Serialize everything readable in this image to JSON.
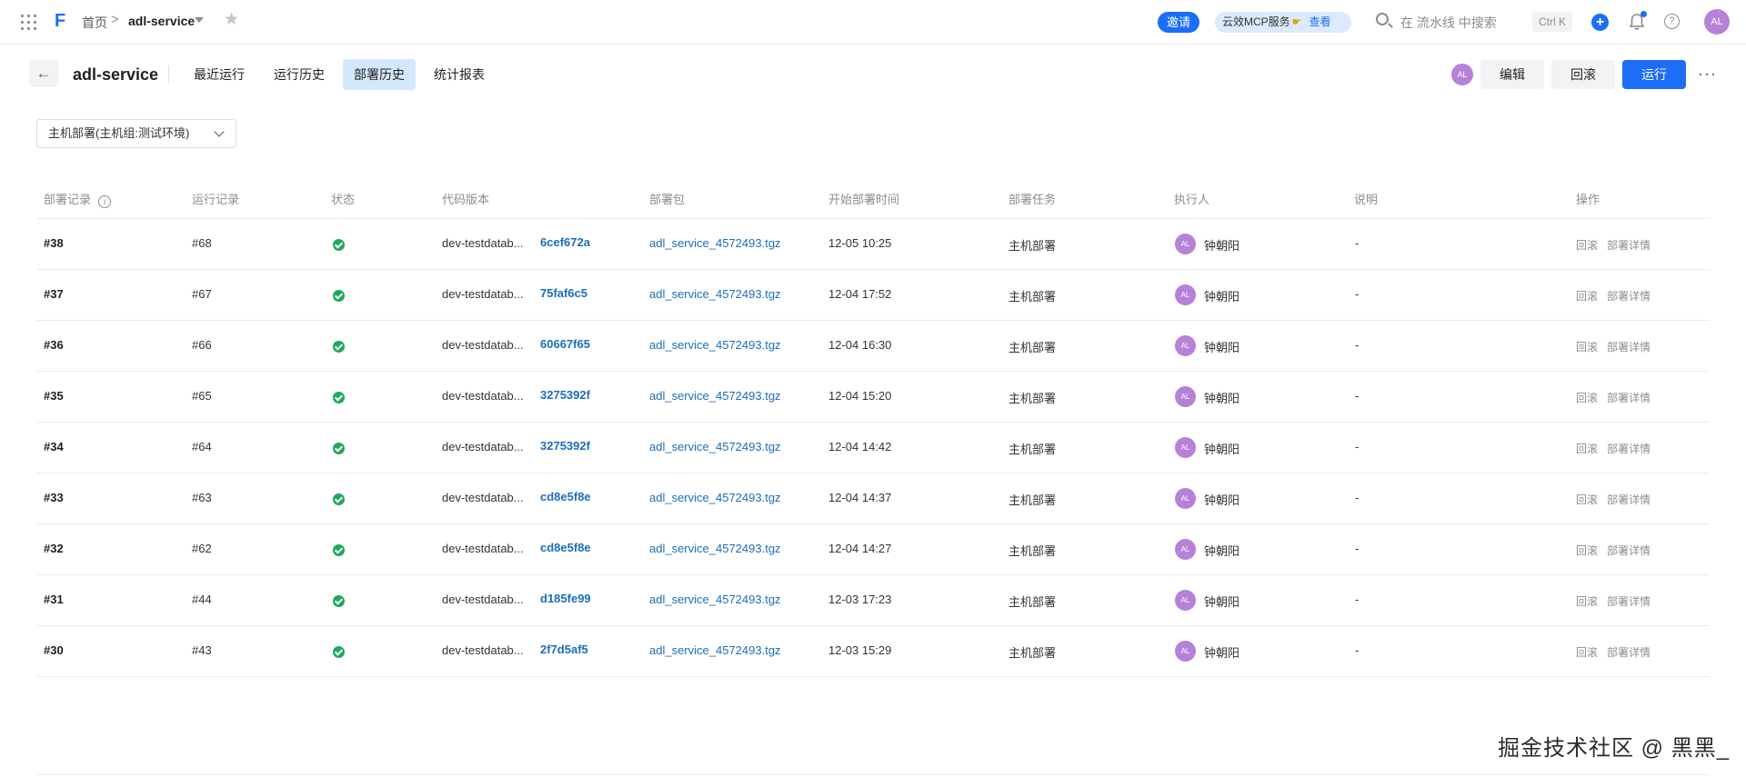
{
  "topbar": {
    "home": "首页",
    "sep": ">",
    "current": "adl-service",
    "invite": "邀请",
    "mcp_text": "云效MCP服务",
    "mcp_view": "查看",
    "search_placeholder": "在 流水线 中搜索",
    "shortcut": "Ctrl K",
    "avatar": "AL"
  },
  "header": {
    "back": "←",
    "title": "adl-service",
    "tabs": [
      {
        "label": "最近运行"
      },
      {
        "label": "运行历史"
      },
      {
        "label": "部署历史"
      },
      {
        "label": "统计报表"
      }
    ],
    "active_tab": "部署历史",
    "avatar": "AL",
    "edit": "编辑",
    "rollback": "回滚",
    "run": "运行",
    "more": "···"
  },
  "filter": {
    "selected": "主机部署(主机组:测试环境)"
  },
  "table": {
    "columns": [
      "部署记录",
      "运行记录",
      "状态",
      "代码版本",
      "部署包",
      "开始部署时间",
      "部署任务",
      "执行人",
      "说明",
      "操作"
    ],
    "rows": [
      {
        "deploy": "#38",
        "run": "#68",
        "branch": "dev-testdatab...",
        "commit": "6cef672a",
        "package": "adl_service_4572493.tgz",
        "time": "12-05 10:25",
        "task": "主机部署",
        "avatar": "AL",
        "user": "钟朝阳",
        "note": "-",
        "op1": "回滚",
        "op2": "部署详情"
      },
      {
        "deploy": "#37",
        "run": "#67",
        "branch": "dev-testdatab...",
        "commit": "75faf6c5",
        "package": "adl_service_4572493.tgz",
        "time": "12-04 17:52",
        "task": "主机部署",
        "avatar": "AL",
        "user": "钟朝阳",
        "note": "-",
        "op1": "回滚",
        "op2": "部署详情"
      },
      {
        "deploy": "#36",
        "run": "#66",
        "branch": "dev-testdatab...",
        "commit": "60667f65",
        "package": "adl_service_4572493.tgz",
        "time": "12-04 16:30",
        "task": "主机部署",
        "avatar": "AL",
        "user": "钟朝阳",
        "note": "-",
        "op1": "回滚",
        "op2": "部署详情"
      },
      {
        "deploy": "#35",
        "run": "#65",
        "branch": "dev-testdatab...",
        "commit": "3275392f",
        "package": "adl_service_4572493.tgz",
        "time": "12-04 15:20",
        "task": "主机部署",
        "avatar": "AL",
        "user": "钟朝阳",
        "note": "-",
        "op1": "回滚",
        "op2": "部署详情"
      },
      {
        "deploy": "#34",
        "run": "#64",
        "branch": "dev-testdatab...",
        "commit": "3275392f",
        "package": "adl_service_4572493.tgz",
        "time": "12-04 14:42",
        "task": "主机部署",
        "avatar": "AL",
        "user": "钟朝阳",
        "note": "-",
        "op1": "回滚",
        "op2": "部署详情"
      },
      {
        "deploy": "#33",
        "run": "#63",
        "branch": "dev-testdatab...",
        "commit": "cd8e5f8e",
        "package": "adl_service_4572493.tgz",
        "time": "12-04 14:37",
        "task": "主机部署",
        "avatar": "AL",
        "user": "钟朝阳",
        "note": "-",
        "op1": "回滚",
        "op2": "部署详情"
      },
      {
        "deploy": "#32",
        "run": "#62",
        "branch": "dev-testdatab...",
        "commit": "cd8e5f8e",
        "package": "adl_service_4572493.tgz",
        "time": "12-04 14:27",
        "task": "主机部署",
        "avatar": "AL",
        "user": "钟朝阳",
        "note": "-",
        "op1": "回滚",
        "op2": "部署详情"
      },
      {
        "deploy": "#31",
        "run": "#44",
        "branch": "dev-testdatab...",
        "commit": "d185fe99",
        "package": "adl_service_4572493.tgz",
        "time": "12-03 17:23",
        "task": "主机部署",
        "avatar": "AL",
        "user": "钟朝阳",
        "note": "-",
        "op1": "回滚",
        "op2": "部署详情"
      },
      {
        "deploy": "#30",
        "run": "#43",
        "branch": "dev-testdatab...",
        "commit": "2f7d5af5",
        "package": "adl_service_4572493.tgz",
        "time": "12-03 15:29",
        "task": "主机部署",
        "avatar": "AL",
        "user": "钟朝阳",
        "note": "-",
        "op1": "回滚",
        "op2": "部署详情"
      }
    ]
  },
  "watermark": "掘金技术社区 @ 黑黑_",
  "colors": {
    "accent": "#1b6ef5",
    "success": "#1fa85b",
    "avatar": "#b681d8",
    "active_tab": "#d4e8fd"
  }
}
